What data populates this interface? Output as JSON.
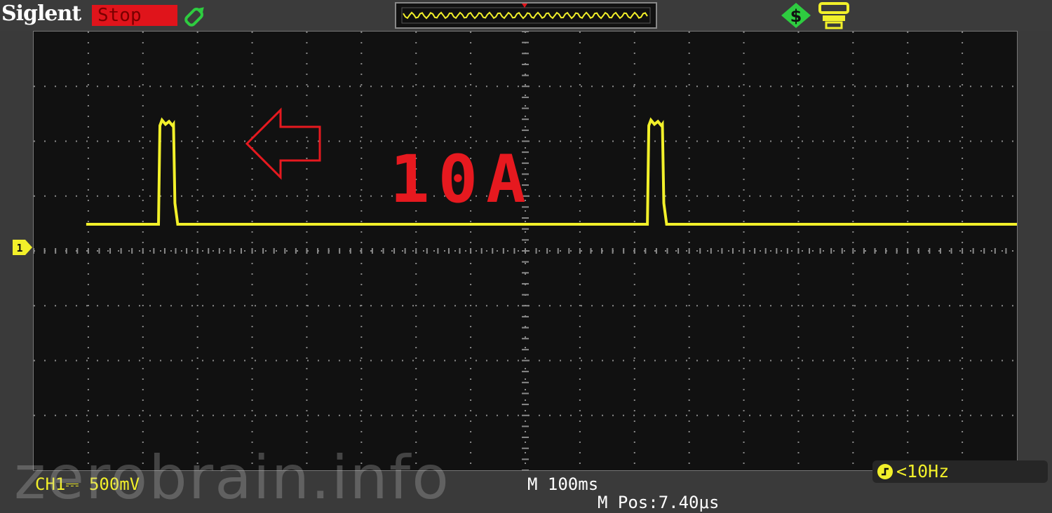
{
  "header": {
    "brand": "Siglent",
    "run_status": "Stop",
    "run_status_color": "#e0141b"
  },
  "annotation": {
    "label": "10A",
    "color": "#e6191f"
  },
  "trace": {
    "channel_marker": "1",
    "color": "#f2f02a",
    "pulses_at_divisions": [
      2.35,
      11.3
    ],
    "pulse_width_divisions": 0.3,
    "pulse_height_divisions": 1.9
  },
  "trigger": {
    "frequency_readout": "<10Hz"
  },
  "footer": {
    "channel_scale": "CH1⎓ 500mV",
    "timebase": "M 100ms",
    "position": "M Pos:7.40μs"
  },
  "watermark": "zerobrain.info",
  "colors": {
    "background": "#3a3a3a",
    "screen": "#111111",
    "grid": "#8a8a8a",
    "icon_green": "#2ecc40"
  }
}
